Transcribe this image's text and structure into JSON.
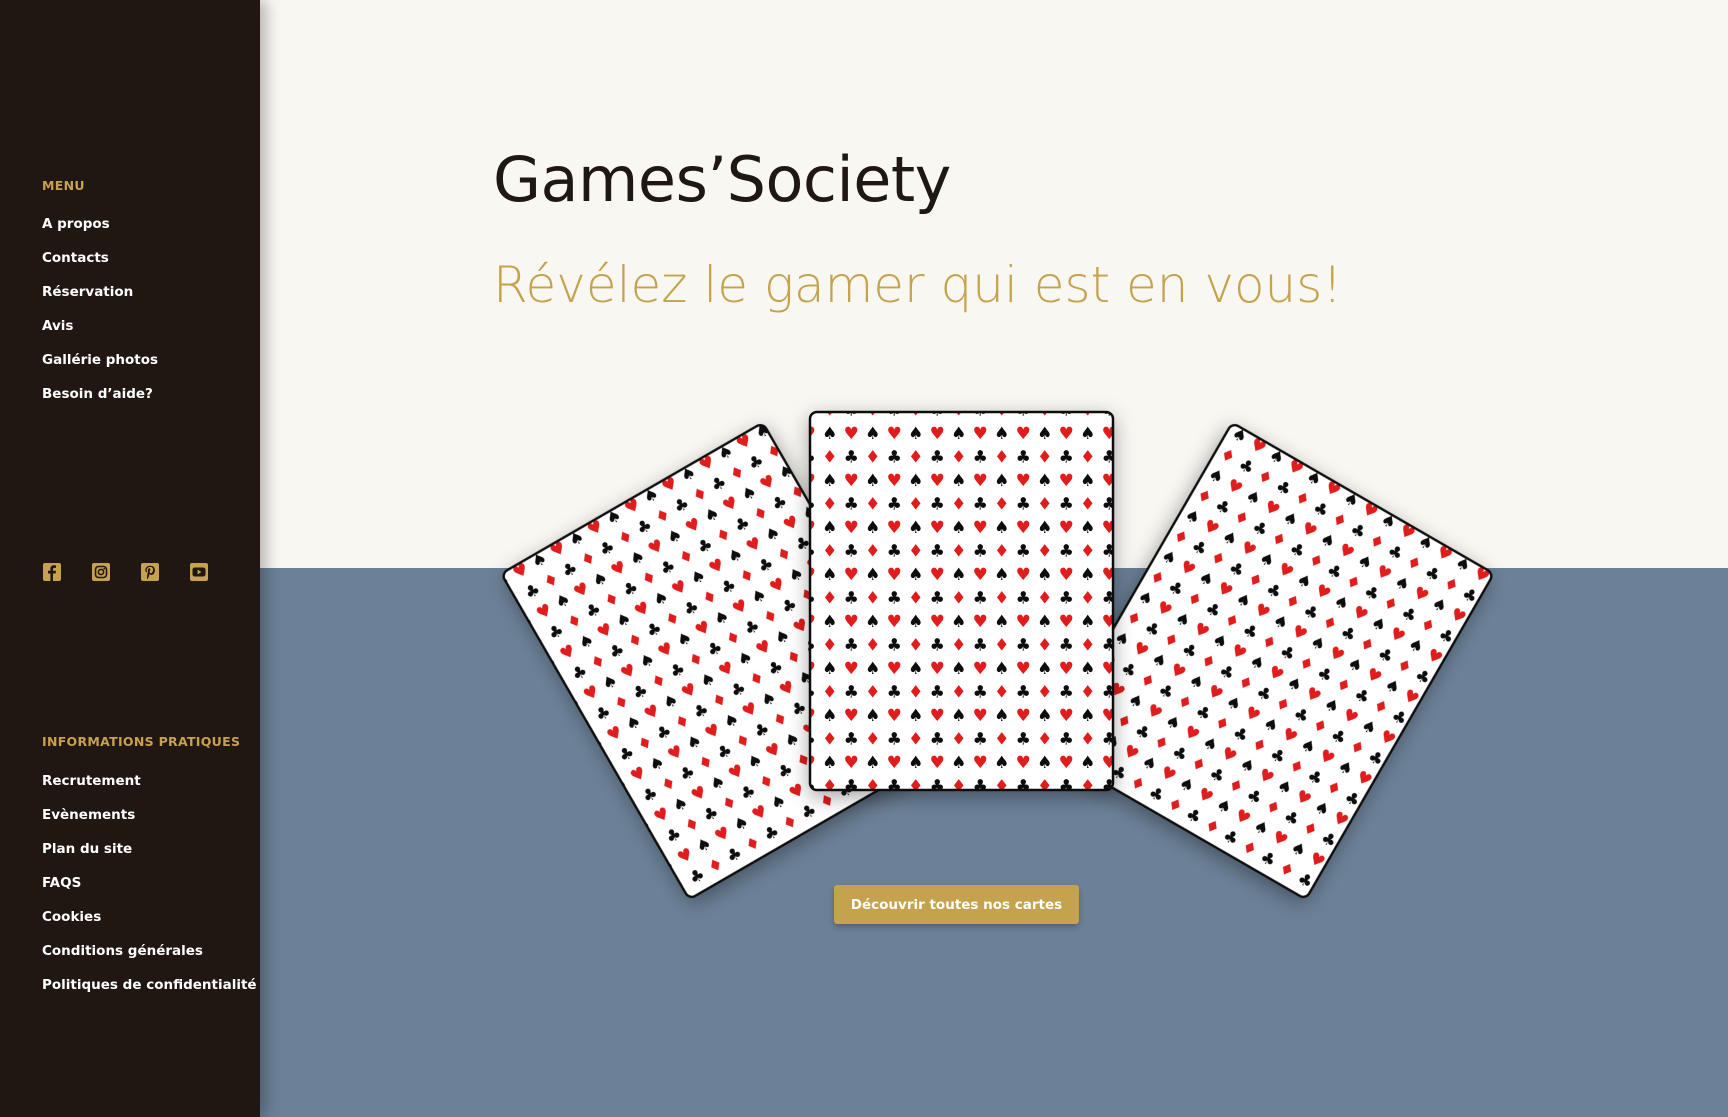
{
  "sidebar": {
    "menu_title": "MENU",
    "menu_items": [
      {
        "label": "A propos"
      },
      {
        "label": "Contacts"
      },
      {
        "label": "Réservation"
      },
      {
        "label": "Avis"
      },
      {
        "label": "Gallérie photos"
      },
      {
        "label": "Besoin d’aide?"
      }
    ],
    "socials": [
      {
        "icon": "facebook-icon"
      },
      {
        "icon": "instagram-icon"
      },
      {
        "icon": "pinterest-icon"
      },
      {
        "icon": "youtube-icon"
      }
    ],
    "info_title": "INFORMATIONS PRATIQUES",
    "info_items": [
      {
        "label": "Recrutement"
      },
      {
        "label": "Evènements"
      },
      {
        "label": "Plan du site"
      },
      {
        "label": "FAQS"
      },
      {
        "label": "Cookies"
      },
      {
        "label": "Conditions générales"
      },
      {
        "label": "Politiques de confidentialité"
      }
    ]
  },
  "hero": {
    "title": "Games’Society",
    "subtitle": "Révélez le gamer qui est en vous!",
    "cta_label": "Découvrir toutes nos cartes"
  },
  "cards": {
    "count": 3,
    "pattern_suits": [
      "♠",
      "♥",
      "♣",
      "♦"
    ]
  },
  "colors": {
    "sidebar_bg": "#211712",
    "accent_gold": "#c4a24e",
    "page_bg": "#f9f7f2",
    "lower_band": "#6c8197",
    "suit_red": "#e01e1e",
    "suit_black": "#111111"
  }
}
